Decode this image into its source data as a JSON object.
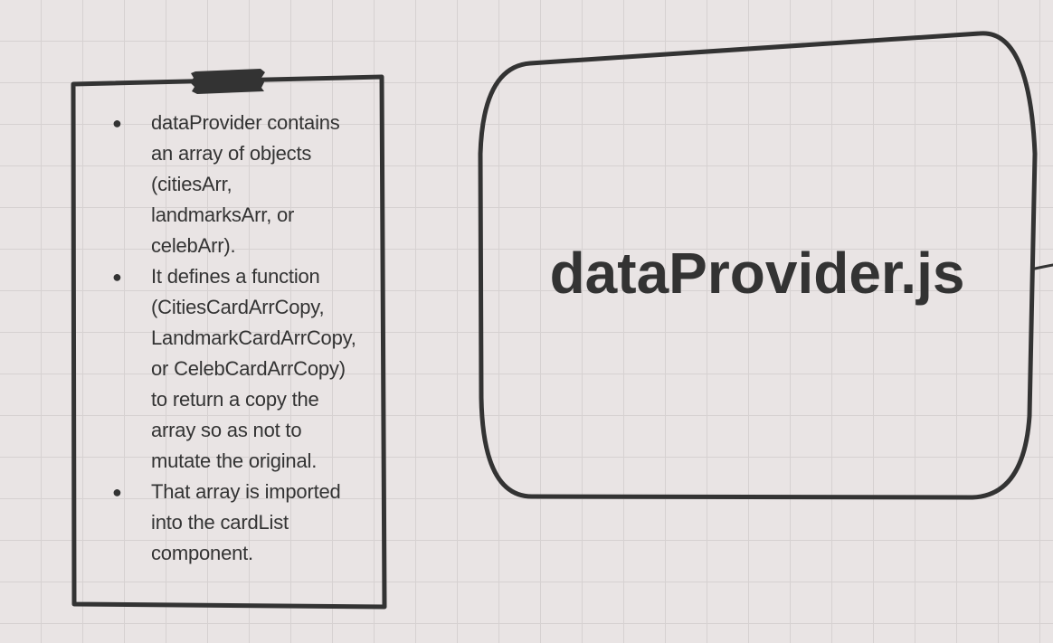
{
  "canvas": {
    "background_color": "#e9e4e4",
    "stroke_color": "#333333"
  },
  "note": {
    "bullets": [
      {
        "lines": [
          "dataProvider contains",
          "an array of objects",
          "(citiesArr,",
          "landmarksArr, or",
          "celebArr)."
        ]
      },
      {
        "lines": [
          "It defines a function",
          "(CitiesCardArrCopy,",
          "LandmarkCardArrCopy,",
          "or CelebCardArrCopy)",
          "to return a copy the",
          "array so as not to",
          "mutate the original."
        ]
      },
      {
        "lines": [
          "That array is imported",
          "into the cardList",
          "component."
        ]
      }
    ],
    "bullet_glyph": "●"
  },
  "node": {
    "title": "dataProvider.js"
  }
}
